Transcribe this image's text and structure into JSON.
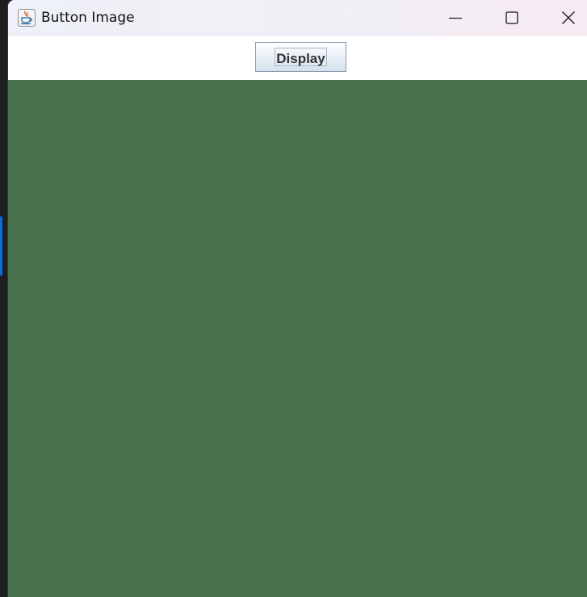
{
  "window": {
    "title": "Button Image",
    "app_icon": "java-cup-icon"
  },
  "window_controls": {
    "minimize_icon": "minimize-icon",
    "maximize_icon": "maximize-icon",
    "close_icon": "close-icon"
  },
  "toolbar": {
    "display_label": "Display"
  },
  "canvas": {
    "color": "#48724c"
  },
  "colors": {
    "desktop_accent": "#0a6cd6"
  }
}
